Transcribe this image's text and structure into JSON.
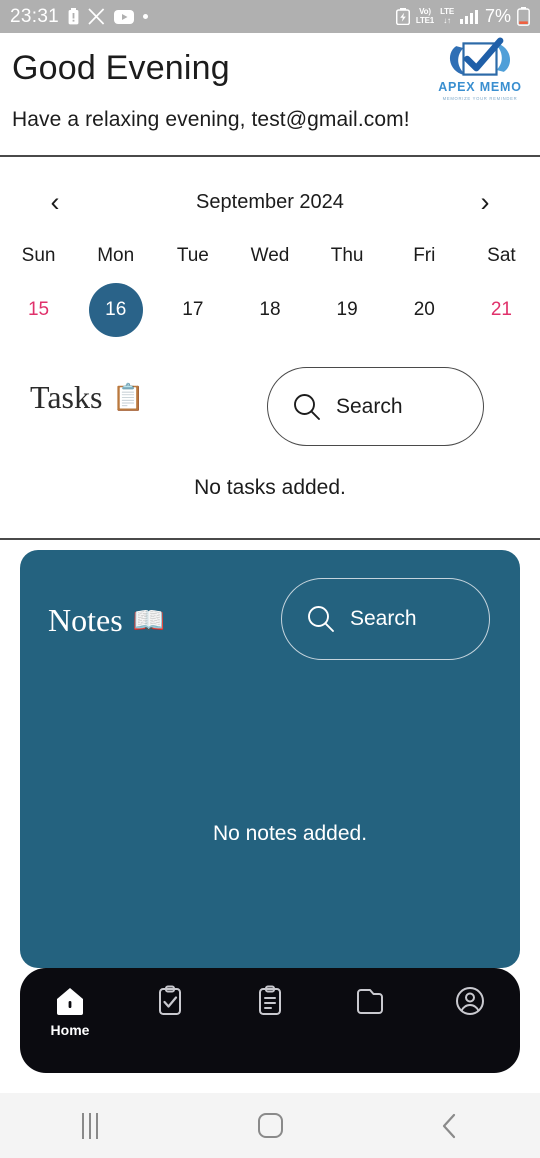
{
  "status_bar": {
    "time": "23:31",
    "left_icons": [
      "battery-alert-icon",
      "x-twitter-icon",
      "youtube-icon",
      "dot-icon"
    ],
    "network_line1": "Vo)",
    "network_line2": "LTE1",
    "lte_label": "LTE",
    "lte_arrows": "↓↑",
    "battery_percent": "7%",
    "right_icons": [
      "battery-saver-icon",
      "volte-icon",
      "lte-data-icon",
      "signal-bars-icon",
      "battery-icon"
    ]
  },
  "header": {
    "greeting_title": "Good Evening",
    "greeting_subtitle": "Have a relaxing evening, test@gmail.com!",
    "logo_name": "APEX MEMO",
    "logo_tagline": "MEMORIZE YOUR REMINDER"
  },
  "calendar": {
    "prev_label": "‹",
    "next_label": "›",
    "month_year": "September 2024",
    "day_names": [
      "Sun",
      "Mon",
      "Tue",
      "Wed",
      "Thu",
      "Fri",
      "Sat"
    ],
    "days": [
      {
        "number": "15",
        "weekend": true,
        "selected": false
      },
      {
        "number": "16",
        "weekend": false,
        "selected": true
      },
      {
        "number": "17",
        "weekend": false,
        "selected": false
      },
      {
        "number": "18",
        "weekend": false,
        "selected": false
      },
      {
        "number": "19",
        "weekend": false,
        "selected": false
      },
      {
        "number": "20",
        "weekend": false,
        "selected": false
      },
      {
        "number": "21",
        "weekend": true,
        "selected": false
      }
    ],
    "selected_color": "#2a6389",
    "weekend_color": "#e0316b"
  },
  "tasks": {
    "title": "Tasks",
    "emoji": "📋",
    "search_label": "Search",
    "empty_text": "No tasks added."
  },
  "notes": {
    "title": "Notes",
    "emoji": "📖",
    "search_label": "Search",
    "empty_text": "No notes added.",
    "card_color": "#24627f"
  },
  "app_nav": {
    "items": [
      {
        "icon": "home-icon",
        "label": "Home",
        "active": true
      },
      {
        "icon": "clipboard-check-icon",
        "label": "",
        "active": false
      },
      {
        "icon": "clipboard-list-icon",
        "label": "",
        "active": false
      },
      {
        "icon": "folder-icon",
        "label": "",
        "active": false
      },
      {
        "icon": "account-circle-icon",
        "label": "",
        "active": false
      }
    ],
    "bar_color": "#0b0b10"
  },
  "system_nav": {
    "recents_label": "recents-icon",
    "home_label": "home-square-icon",
    "back_label": "back-chevron-icon"
  }
}
